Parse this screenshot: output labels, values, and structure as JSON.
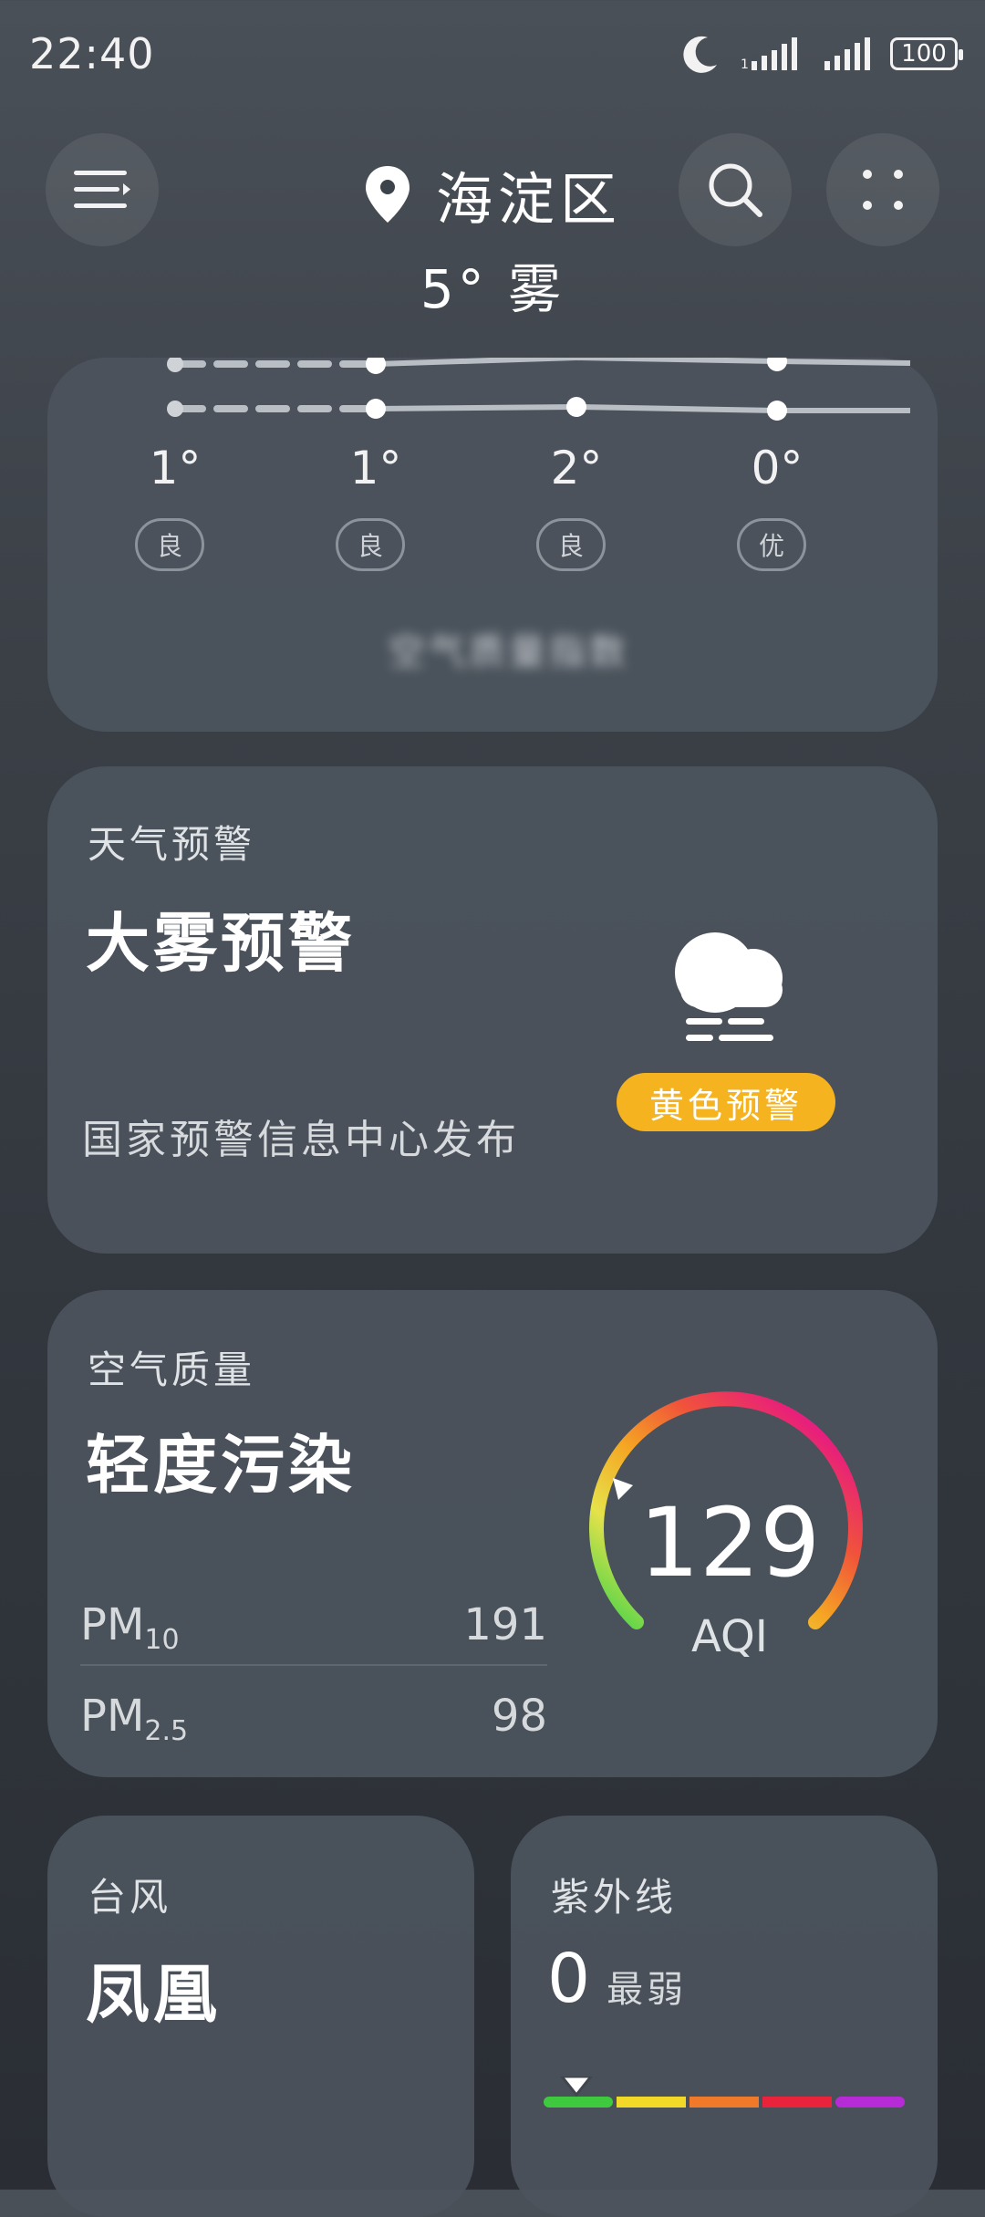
{
  "status_bar": {
    "time": "22:40",
    "battery": "100"
  },
  "header": {
    "location": "海淀区",
    "current": {
      "temp": "5°",
      "condition": "雾"
    }
  },
  "hourly": {
    "temps": [
      "1°",
      "1°",
      "2°",
      "0°"
    ],
    "aqi_levels": [
      "良",
      "良",
      "良",
      "优"
    ],
    "blurred_text": "空气质量指数"
  },
  "warning_card": {
    "label": "天气预警",
    "title": "大雾预警",
    "badge": "黄色预警",
    "source": "国家预警信息中心发布",
    "badge_color": "#f5b320"
  },
  "air_card": {
    "label": "空气质量",
    "title": "轻度污染",
    "aqi_value": "129",
    "aqi_unit": "AQI",
    "pm10": {
      "label": "PM",
      "sub": "10",
      "value": "191"
    },
    "pm25": {
      "label": "PM",
      "sub": "2.5",
      "value": "98"
    },
    "gauge_colors": [
      "#3fd24a",
      "#e6e24a",
      "#f5a623",
      "#f0533a",
      "#e8207a",
      "#c31cc8"
    ]
  },
  "typhoon_card": {
    "label": "台风",
    "title": "凤凰"
  },
  "uv_card": {
    "label": "紫外线",
    "value": "0",
    "level": "最弱",
    "scale_colors": [
      "#3fc93f",
      "#f2d827",
      "#f07a2a",
      "#e8233b",
      "#b72bd6"
    ]
  }
}
